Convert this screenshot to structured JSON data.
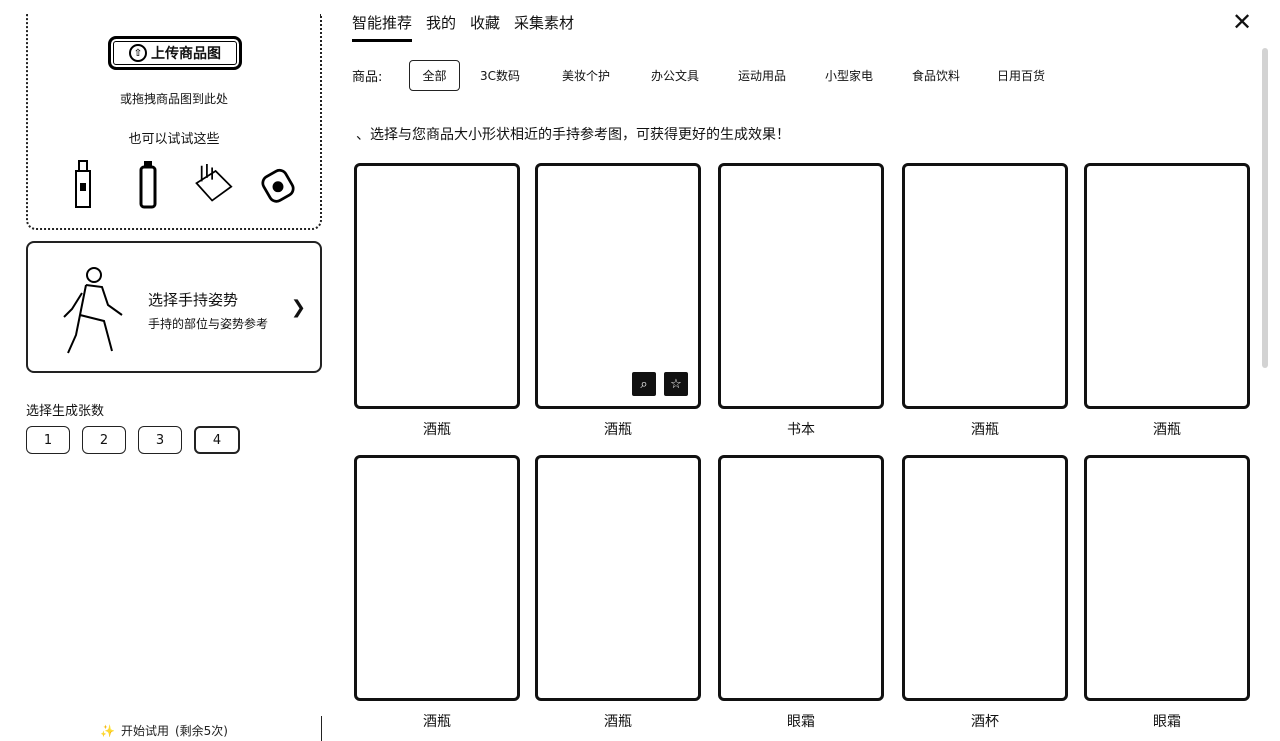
{
  "upload": {
    "button_label": "上传商品图",
    "drop_hint": "或拖拽商品图到此处",
    "try_label": "也可以试试这些",
    "samples": [
      "bottle-sample-icon",
      "can-sample-icon",
      "box-sample-icon",
      "cosmetic-sample-icon"
    ]
  },
  "pose": {
    "title": "选择手持姿势",
    "subtitle": "手持的部位与姿势参考"
  },
  "count": {
    "label": "选择生成张数",
    "options": [
      "1",
      "2",
      "3",
      "4"
    ]
  },
  "footer": {
    "start_label": "开始试用",
    "remaining": "(剩余5次)"
  },
  "tabs": [
    "智能推荐",
    "我的",
    "收藏",
    "采集素材"
  ],
  "active_tab": "智能推荐",
  "category": {
    "label": "商品:",
    "items": [
      "全部",
      "3C数码",
      "美妆个护",
      "办公文具",
      "运动用品",
      "小型家电",
      "食品饮料",
      "日用百货"
    ],
    "active": "全部"
  },
  "hint": "、选择与您商品大小形状相近的手持参考图，可获得更好的生成效果！",
  "gallery": [
    {
      "caption": "酒瓶"
    },
    {
      "caption": "酒瓶"
    },
    {
      "caption": "书本"
    },
    {
      "caption": "酒瓶"
    },
    {
      "caption": "酒瓶"
    },
    {
      "caption": "酒瓶"
    },
    {
      "caption": "酒瓶"
    },
    {
      "caption": "眼霜"
    },
    {
      "caption": "酒杯"
    },
    {
      "caption": "眼霜"
    }
  ],
  "icons": {
    "close": "close-icon",
    "pose_arrow": "chevron-right-icon",
    "zoom": "zoom-icon",
    "favorite": "star-icon",
    "start": "wand-icon"
  }
}
